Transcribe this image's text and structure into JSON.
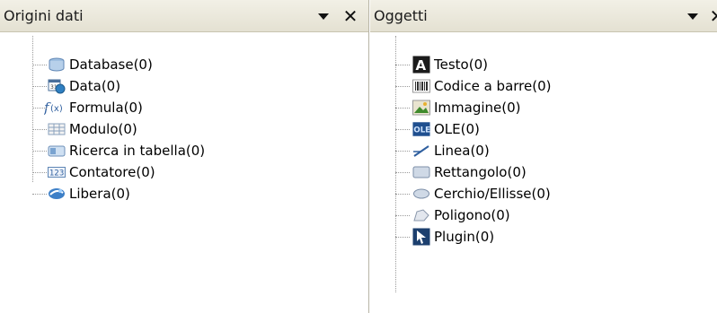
{
  "left_panel": {
    "title": "Origini dati",
    "items": [
      {
        "label": "Database(0)",
        "icon": "database-icon"
      },
      {
        "label": "Data(0)",
        "icon": "calendar-icon"
      },
      {
        "label": "Formula(0)",
        "icon": "formula-icon"
      },
      {
        "label": "Modulo(0)",
        "icon": "form-grid-icon"
      },
      {
        "label": "Ricerca in tabella(0)",
        "icon": "table-lookup-icon"
      },
      {
        "label": "Contatore(0)",
        "icon": "counter-icon"
      },
      {
        "label": "Libera(0)",
        "icon": "free-icon"
      }
    ]
  },
  "right_panel": {
    "title": "Oggetti",
    "items": [
      {
        "label": "Testo(0)",
        "icon": "text-icon"
      },
      {
        "label": "Codice a barre(0)",
        "icon": "barcode-icon"
      },
      {
        "label": "Immagine(0)",
        "icon": "image-icon"
      },
      {
        "label": "OLE(0)",
        "icon": "ole-icon"
      },
      {
        "label": "Linea(0)",
        "icon": "line-icon"
      },
      {
        "label": "Rettangolo(0)",
        "icon": "rectangle-icon"
      },
      {
        "label": "Cerchio/Ellisse(0)",
        "icon": "ellipse-icon"
      },
      {
        "label": "Poligono(0)",
        "icon": "polygon-icon"
      },
      {
        "label": "Plugin(0)",
        "icon": "plugin-icon"
      }
    ]
  }
}
